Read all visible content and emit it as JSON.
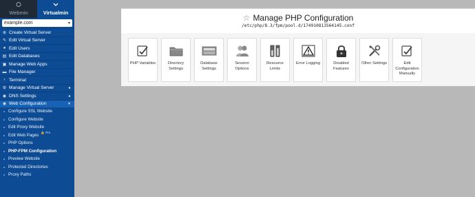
{
  "tabs": [
    {
      "label": "Webmin",
      "icon": "webmin-icon"
    },
    {
      "label": "Virtualmin",
      "icon": "chevron-down-icon"
    }
  ],
  "domain_select": {
    "value": "example.com"
  },
  "menu": [
    {
      "label": "Create Virtual Server",
      "icon": "plus-icon"
    },
    {
      "label": "Edit Virtual Server",
      "icon": "edit-icon"
    },
    {
      "label": "Edit Users",
      "icon": "users-icon"
    },
    {
      "label": "Edit Databases",
      "icon": "database-icon"
    },
    {
      "label": "Manage Web Apps",
      "icon": "apps-icon"
    },
    {
      "label": "File Manager",
      "icon": "folder-icon"
    },
    {
      "label": "Terminal",
      "icon": "terminal-icon"
    },
    {
      "label": "Manage Virtual Server",
      "icon": "gear-icon"
    },
    {
      "label": "DNS Settings",
      "icon": "globe-icon"
    },
    {
      "label": "Web Configuration",
      "icon": "globe-icon"
    }
  ],
  "submenu": [
    {
      "label": "Configure SSL Website"
    },
    {
      "label": "Configure Website"
    },
    {
      "label": "Edit Proxy Website"
    },
    {
      "label": "Edit Web Pages",
      "badge": "Pro"
    },
    {
      "label": "PHP Options"
    },
    {
      "label": "PHP-FPM Configuration"
    },
    {
      "label": "Preview Website"
    },
    {
      "label": "Protected Directories"
    },
    {
      "label": "Proxy Paths"
    }
  ],
  "page": {
    "title": "Manage PHP Configuration",
    "path": "/etc/php/8.3/fpm/pool.d/174910813564145.conf"
  },
  "tiles": [
    {
      "label": "PHP Variables",
      "icon": "edit-sheet-icon"
    },
    {
      "label": "Directory Settings",
      "icon": "folder-icon"
    },
    {
      "label": "Database Settings",
      "icon": "database-icon"
    },
    {
      "label": "Session Options",
      "icon": "users-icon"
    },
    {
      "label": "Resource Limits",
      "icon": "resource-limits-icon"
    },
    {
      "label": "Error Logging",
      "icon": "warning-icon"
    },
    {
      "label": "Disabled Features",
      "icon": "lock-icon"
    },
    {
      "label": "Other Settings",
      "icon": "tools-icon"
    },
    {
      "label": "Edit Configuration Manually",
      "icon": "edit-sheet-icon"
    }
  ]
}
